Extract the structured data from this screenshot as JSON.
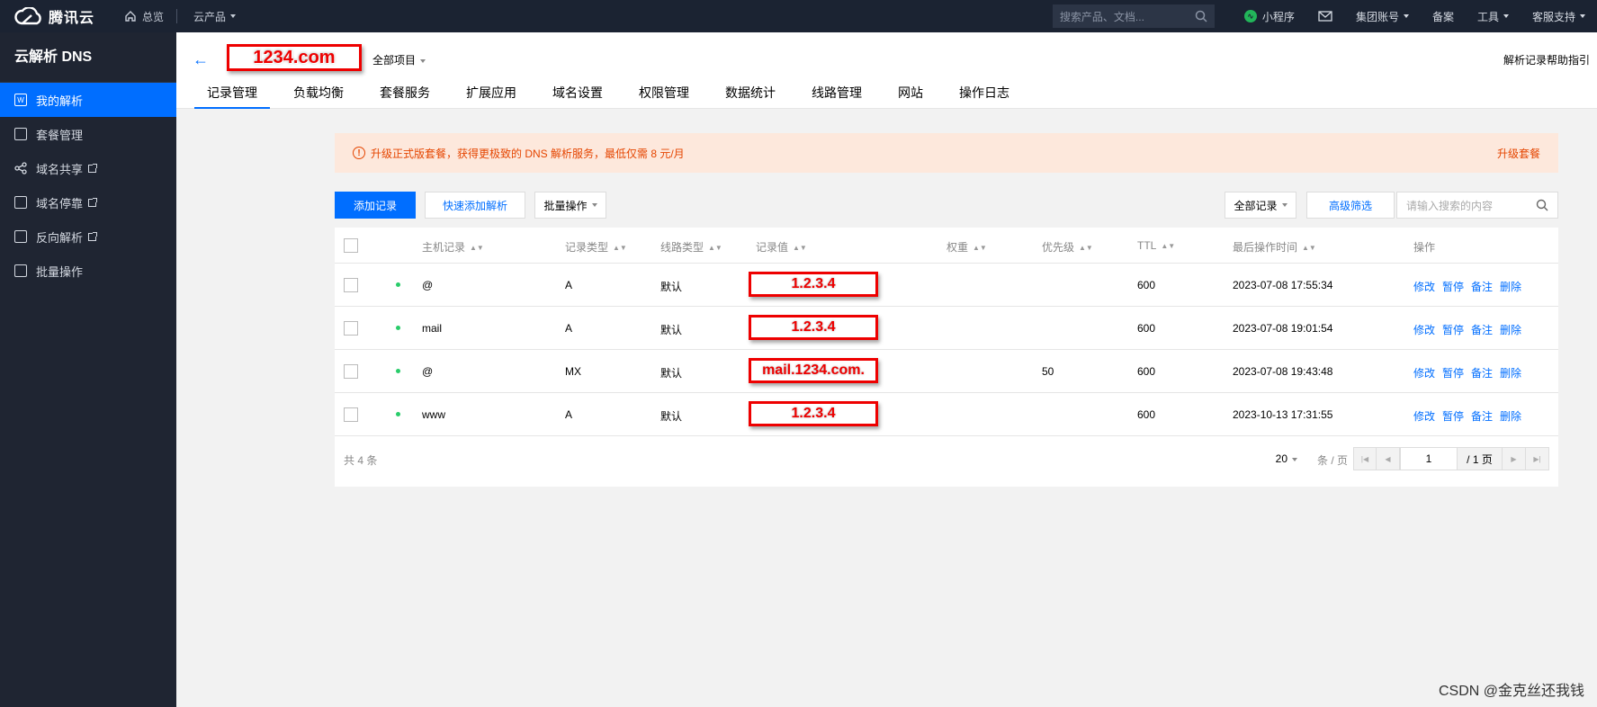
{
  "topbar": {
    "brand": "腾讯云",
    "home": "总览",
    "products": "云产品",
    "search_placeholder": "搜索产品、文档...",
    "mini_program": "小程序",
    "group_account": "集团账号",
    "filing": "备案",
    "tools": "工具",
    "support": "客服支持"
  },
  "sidebar": {
    "title": "云解析 DNS",
    "items": [
      {
        "label": "我的解析",
        "active": true,
        "icon": "w-icon"
      },
      {
        "label": "套餐管理",
        "icon": "package-icon"
      },
      {
        "label": "域名共享",
        "icon": "share-icon",
        "external": true
      },
      {
        "label": "域名停靠",
        "icon": "parking-icon",
        "external": true
      },
      {
        "label": "反向解析",
        "icon": "reverse-icon",
        "external": true
      },
      {
        "label": "批量操作",
        "icon": "batch-icon"
      }
    ]
  },
  "header": {
    "domain": "1234.com",
    "project": "全部项目",
    "help": "解析记录帮助指引",
    "tabs": [
      "记录管理",
      "负载均衡",
      "套餐服务",
      "扩展应用",
      "域名设置",
      "权限管理",
      "数据统计",
      "线路管理",
      "网站",
      "操作日志"
    ],
    "active_tab": 0
  },
  "banner": {
    "message": "升级正式版套餐，获得更极致的 DNS 解析服务，最低仅需 8 元/月",
    "action": "升级套餐",
    "color": "#e54500"
  },
  "toolbar": {
    "add": "添加记录",
    "quick_add": "快速添加解析",
    "batch": "批量操作",
    "filter_select": "全部记录",
    "advanced": "高级筛选",
    "search_placeholder": "请输入搜索的内容"
  },
  "table": {
    "headers": [
      "主机记录",
      "记录类型",
      "线路类型",
      "记录值",
      "权重",
      "优先级",
      "TTL",
      "最后操作时间",
      "操作"
    ],
    "rows": [
      {
        "host": "@",
        "type": "A",
        "line": "默认",
        "value": "1.2.3.4",
        "weight": "",
        "priority": "",
        "ttl": "600",
        "time": "2023-07-08 17:55:34"
      },
      {
        "host": "mail",
        "type": "A",
        "line": "默认",
        "value": "1.2.3.4",
        "weight": "",
        "priority": "",
        "ttl": "600",
        "time": "2023-07-08 19:01:54"
      },
      {
        "host": "@",
        "type": "MX",
        "line": "默认",
        "value": "mail.1234.com.",
        "weight": "",
        "priority": "50",
        "ttl": "600",
        "time": "2023-07-08 19:43:48"
      },
      {
        "host": "www",
        "type": "A",
        "line": "默认",
        "value": "1.2.3.4",
        "weight": "",
        "priority": "",
        "ttl": "600",
        "time": "2023-10-13 17:31:55"
      }
    ],
    "actions": [
      "修改",
      "暂停",
      "备注",
      "删除"
    ],
    "total": "共 4 条",
    "page_size": "20",
    "page_unit": "条 / 页",
    "page_current": "1",
    "page_total": "/ 1 页"
  },
  "watermark": "CSDN @金克丝还我钱",
  "colors": {
    "primary": "#006eff",
    "nav_bg": "#1b2332",
    "sidebar_bg": "#1f2532",
    "annotation_red": "#e00"
  }
}
